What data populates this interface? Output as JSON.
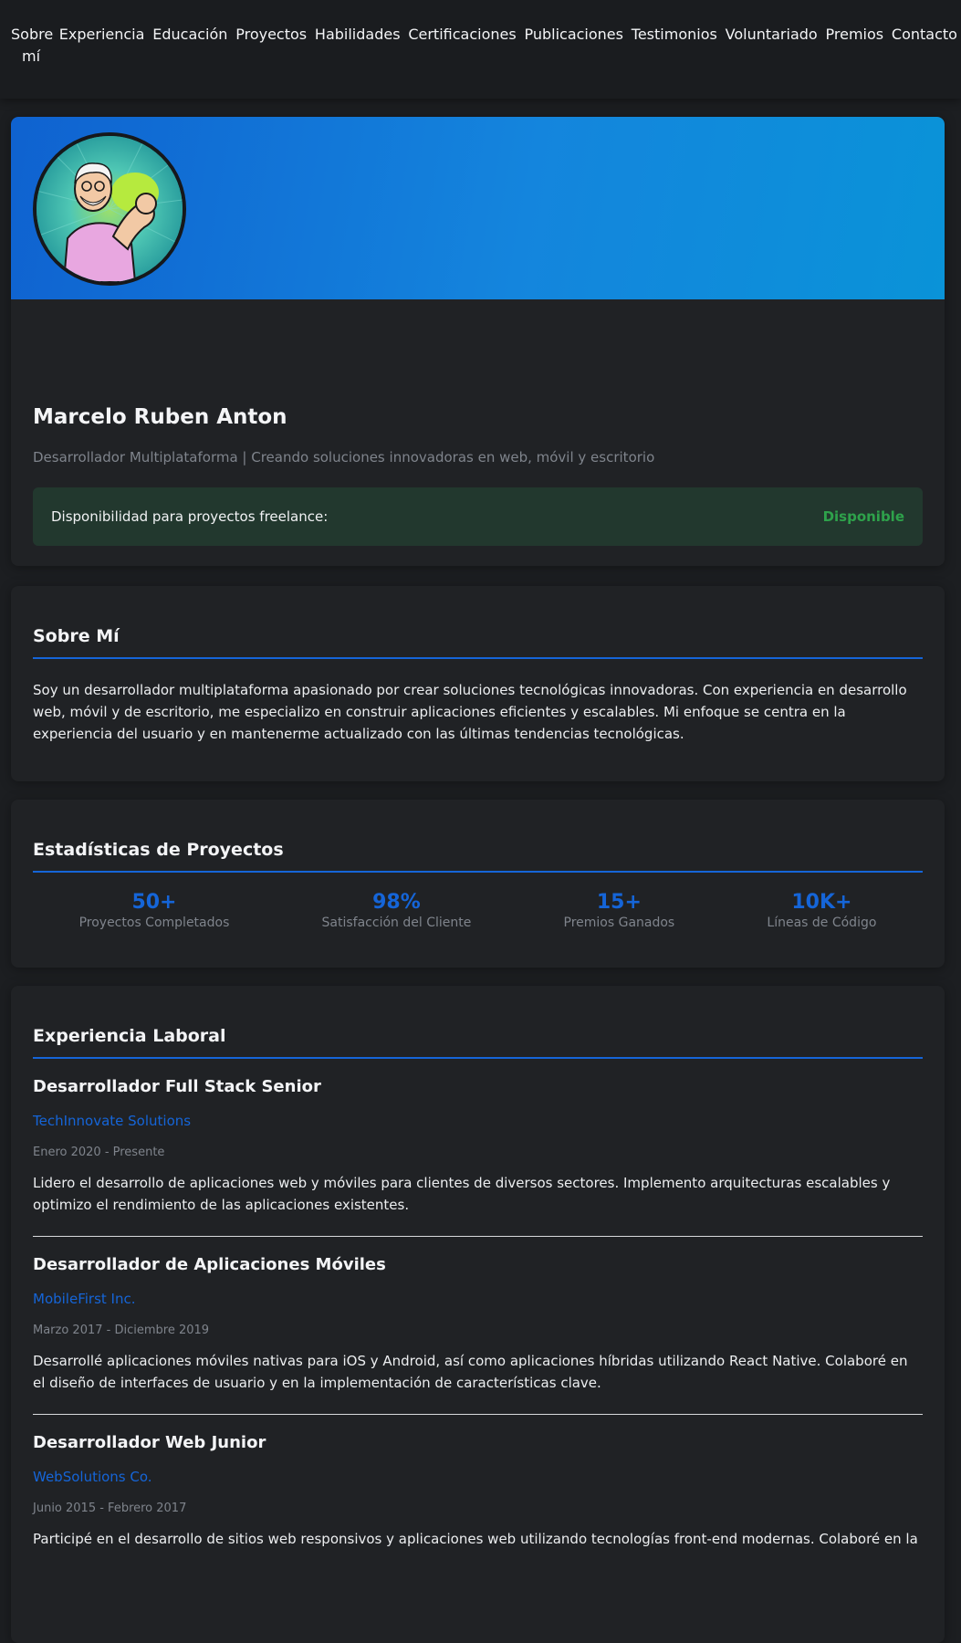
{
  "nav": [
    {
      "label": "Sobre mí"
    },
    {
      "label": "Experiencia"
    },
    {
      "label": "Educación"
    },
    {
      "label": "Proyectos"
    },
    {
      "label": "Habilidades"
    },
    {
      "label": "Certificaciones"
    },
    {
      "label": "Publicaciones"
    },
    {
      "label": "Testimonios"
    },
    {
      "label": "Voluntariado"
    },
    {
      "label": "Premios"
    },
    {
      "label": "Contacto"
    }
  ],
  "hero": {
    "name": "Marcelo Ruben Anton",
    "tagline": "Desarrollador Multiplataforma | Creando soluciones innovadoras en web, móvil y escritorio",
    "availability_label": "Disponibilidad para proyectos freelance:",
    "availability_value": "Disponible"
  },
  "about": {
    "title": "Sobre Mí",
    "text": "Soy un desarrollador multiplataforma apasionado por crear soluciones tecnológicas innovadoras. Con experiencia en desarrollo web, móvil y de escritorio, me especializo en construir aplicaciones eficientes y escalables. Mi enfoque se centra en la experiencia del usuario y en mantenerme actualizado con las últimas tendencias tecnológicas."
  },
  "stats": {
    "title": "Estadísticas de Proyectos",
    "items": [
      {
        "value": "50+",
        "label": "Proyectos Completados"
      },
      {
        "value": "98%",
        "label": "Satisfacción del Cliente"
      },
      {
        "value": "15+",
        "label": "Premios Ganados"
      },
      {
        "value": "10K+",
        "label": "Líneas de Código"
      }
    ]
  },
  "experience": {
    "title": "Experiencia Laboral",
    "jobs": [
      {
        "title": "Desarrollador Full Stack Senior",
        "company": "TechInnovate Solutions",
        "dates": "Enero 2020 - Presente",
        "description": "Lidero el desarrollo de aplicaciones web y móviles para clientes de diversos sectores. Implemento arquitecturas escalables y optimizo el rendimiento de las aplicaciones existentes."
      },
      {
        "title": "Desarrollador de Aplicaciones Móviles",
        "company": "MobileFirst Inc.",
        "dates": "Marzo 2017 - Diciembre 2019",
        "description": "Desarrollé aplicaciones móviles nativas para iOS y Android, así como aplicaciones híbridas utilizando React Native. Colaboré en el diseño de interfaces de usuario y en la implementación de características clave."
      },
      {
        "title": "Desarrollador Web Junior",
        "company": "WebSolutions Co.",
        "dates": "Junio 2015 - Febrero 2017",
        "description": "Participé en el desarrollo de sitios web responsivos y aplicaciones web utilizando tecnologías front-end modernas. Colaboré en la"
      }
    ]
  },
  "colors": {
    "accent": "#1565d8",
    "available": "#2ea24b",
    "background": "#1c1e21",
    "card": "#202225"
  }
}
